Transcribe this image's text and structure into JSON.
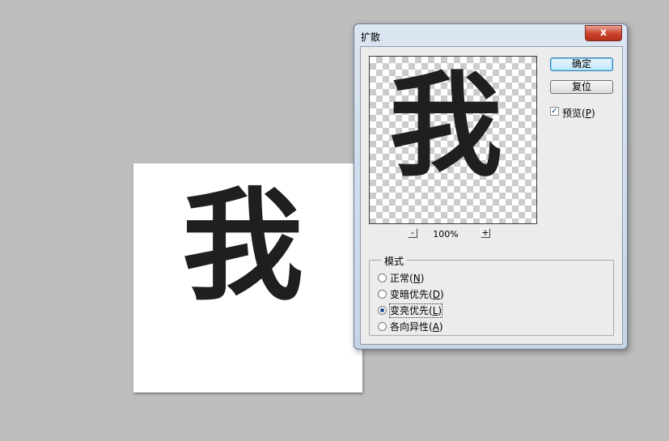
{
  "canvas": {
    "character": "我"
  },
  "dialog": {
    "title": "扩散",
    "close_glyph": "x",
    "preview": {
      "character": "我",
      "zoom_minus": "-",
      "zoom_plus": "+",
      "zoom_level": "100%"
    },
    "buttons": {
      "ok": "确定",
      "reset": "复位"
    },
    "preview_checkbox": {
      "label": "预览",
      "accel_open": "(",
      "accel": "P",
      "accel_close": ")",
      "checked_glyph": "✓",
      "checked": true
    },
    "mode": {
      "legend": "模式",
      "options": [
        {
          "label": "正常",
          "accel": "N",
          "selected": false
        },
        {
          "label": "变暗优先",
          "accel": "D",
          "selected": false
        },
        {
          "label": "变亮优先",
          "accel": "L",
          "selected": true
        },
        {
          "label": "各向异性",
          "accel": "A",
          "selected": false
        }
      ]
    }
  }
}
